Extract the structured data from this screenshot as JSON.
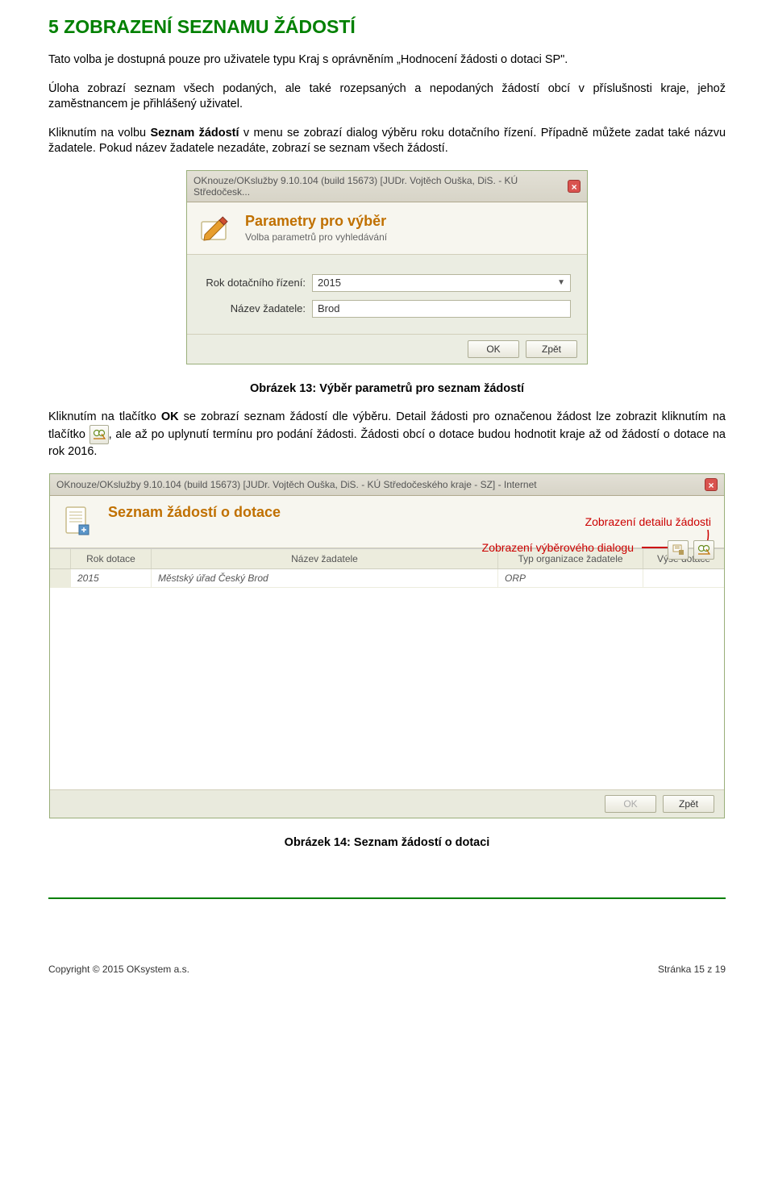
{
  "heading": "5 ZOBRAZENÍ SEZNAMU ŽÁDOSTÍ",
  "para1a": "Tato volba je dostupná pouze pro uživatele typu Kraj s oprávněním „Hodnocení žádosti o dotaci SP\".",
  "para1b": "Úloha zobrazí seznam všech podaných, ale také rozepsaných a nepodaných žádostí obcí v příslušnosti kraje, jehož zaměstnancem je přihlášený uživatel.",
  "para2a": "Kliknutím na volbu ",
  "para2b": "Seznam žádostí",
  "para2c": " v menu se zobrazí dialog výběru roku dotačního řízení. Případně můžete zadat také názvu žadatele. Pokud název žadatele nezadáte, zobrazí se seznam všech žádostí.",
  "dialog1": {
    "title": "OKnouze/OKslužby 9.10.104 (build 15673) [JUDr. Vojtěch Ouška, DiS. - KÚ Středočesk...",
    "panel_title": "Parametry pro výběr",
    "panel_subtitle": "Volba parametrů pro vyhledávání",
    "row1_label": "Rok dotačního řízení:",
    "row1_value": "2015",
    "row2_label": "Název žadatele:",
    "row2_value": "Brod",
    "ok": "OK",
    "back": "Zpět"
  },
  "caption1": "Obrázek 13: Výběr parametrů pro seznam žádostí",
  "para3a": "Kliknutím na tlačítko ",
  "para3b": "OK",
  "para3c": " se zobrazí seznam žádostí dle výběru. Detail žádosti pro označenou žádost lze zobrazit kliknutím na tlačítko ",
  "para3d": ", ale až po uplynutí termínu pro podání žádosti. Žádosti obcí o dotace budou hodnotit kraje až od žádostí o dotace na rok 2016.",
  "dialog2": {
    "title": "OKnouze/OKslužby 9.10.104 (build 15673) [JUDr. Vojtěch Ouška, DiS. - KÚ Středočeského kraje - SZ] - Internet",
    "panel_title": "Seznam žádostí o dotace",
    "anno_detail": "Zobrazení detailu žádosti",
    "anno_dialog": "Zobrazení výběrového dialogu",
    "columns": [
      "Rok dotace",
      "Název žadatele",
      "Typ organizace žadatele",
      "Výše dotace"
    ],
    "row": [
      "2015",
      "Městský úřad Český Brod",
      "ORP",
      ""
    ],
    "ok": "OK",
    "back": "Zpět"
  },
  "caption2": "Obrázek 14: Seznam žádostí o dotaci",
  "footer_left": "Copyright © 2015 OKsystem a.s.",
  "footer_right": "Stránka 15 z 19"
}
